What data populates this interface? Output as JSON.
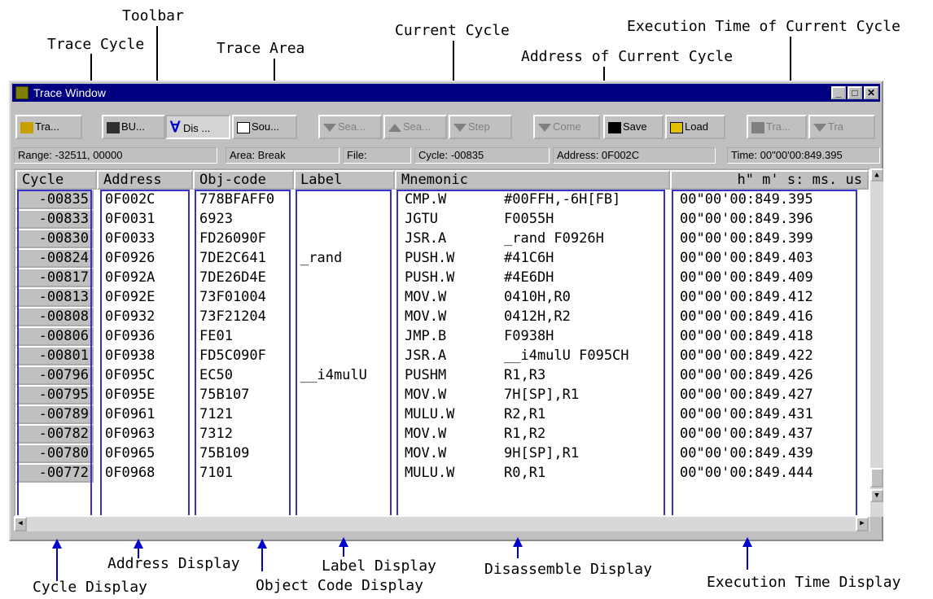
{
  "annotations": {
    "toolbar": "Toolbar",
    "trace_cycle": "Trace Cycle",
    "trace_area": "Trace Area",
    "current_cycle": "Current Cycle",
    "exec_time_current": "Execution Time of Current Cycle",
    "address_current": "Address of Current Cycle",
    "address_display": "Address Display",
    "cycle_display": "Cycle Display",
    "object_code_display": "Object Code Display",
    "label_display": "Label Display",
    "disassemble_display": "Disassemble Display",
    "execution_time_display": "Execution Time Display"
  },
  "window": {
    "title": "Trace Window",
    "min": "_",
    "max": "□",
    "close": "✕"
  },
  "toolbar": {
    "buttons": [
      {
        "label": "Tra...",
        "icon": "trace-icon"
      },
      {
        "label": "BU...",
        "icon": "bus-icon"
      },
      {
        "label": "Dis ...",
        "icon": "disassemble-icon",
        "prefix": "∀"
      },
      {
        "label": "Sou...",
        "icon": "source-icon"
      },
      {
        "label": "Sea...",
        "icon": "search-down-icon"
      },
      {
        "label": "Sea...",
        "icon": "search-up-icon"
      },
      {
        "label": "Step",
        "icon": "step-icon"
      },
      {
        "label": "Come",
        "icon": "come-icon"
      },
      {
        "label": "Save",
        "icon": "save-icon"
      },
      {
        "label": "Load",
        "icon": "load-icon"
      },
      {
        "label": "Tra...",
        "icon": "trace-stop-icon"
      },
      {
        "label": "Tra",
        "icon": "trace-next-icon"
      }
    ]
  },
  "status": {
    "range": "Range: -32511,  00000",
    "area": "Area: Break",
    "file": "File:",
    "cycle": "Cycle: -00835",
    "address": "Address: 0F002C",
    "time": "Time: 00\"00'00:849.395"
  },
  "columns": {
    "cycle": "Cycle",
    "address": "Address",
    "objcode": "Obj-code",
    "label": "Label",
    "mnemonic": "Mnemonic",
    "time": "h\"  m'  s: ms. us"
  },
  "rows": [
    {
      "cycle": "-00835",
      "address": "0F002C",
      "obj": "778BFAFF0",
      "label": "",
      "mn": "CMP.W",
      "op": "#00FFH,-6H[FB]",
      "time": "00\"00'00:849.395"
    },
    {
      "cycle": "-00833",
      "address": "0F0031",
      "obj": "6923",
      "label": "",
      "mn": "JGTU",
      "op": "F0055H",
      "time": "00\"00'00:849.396"
    },
    {
      "cycle": "-00830",
      "address": "0F0033",
      "obj": "FD26090F",
      "label": "",
      "mn": "JSR.A",
      "op": "_rand F0926H",
      "time": "00\"00'00:849.399"
    },
    {
      "cycle": "-00824",
      "address": "0F0926",
      "obj": "7DE2C641",
      "label": "_rand",
      "mn": "PUSH.W",
      "op": "#41C6H",
      "time": "00\"00'00:849.403"
    },
    {
      "cycle": "-00817",
      "address": "0F092A",
      "obj": "7DE26D4E",
      "label": "",
      "mn": "PUSH.W",
      "op": "#4E6DH",
      "time": "00\"00'00:849.409"
    },
    {
      "cycle": "-00813",
      "address": "0F092E",
      "obj": "73F01004",
      "label": "",
      "mn": "MOV.W",
      "op": "0410H,R0",
      "time": "00\"00'00:849.412"
    },
    {
      "cycle": "-00808",
      "address": "0F0932",
      "obj": "73F21204",
      "label": "",
      "mn": "MOV.W",
      "op": "0412H,R2",
      "time": "00\"00'00:849.416"
    },
    {
      "cycle": "-00806",
      "address": "0F0936",
      "obj": "FE01",
      "label": "",
      "mn": "JMP.B",
      "op": "F0938H",
      "time": "00\"00'00:849.418"
    },
    {
      "cycle": "-00801",
      "address": "0F0938",
      "obj": "FD5C090F",
      "label": "",
      "mn": "JSR.A",
      "op": "__i4mulU F095CH",
      "time": "00\"00'00:849.422"
    },
    {
      "cycle": "-00796",
      "address": "0F095C",
      "obj": "EC50",
      "label": "__i4mulU",
      "mn": "PUSHM",
      "op": "R1,R3",
      "time": "00\"00'00:849.426"
    },
    {
      "cycle": "-00795",
      "address": "0F095E",
      "obj": "75B107",
      "label": "",
      "mn": "MOV.W",
      "op": "7H[SP],R1",
      "time": "00\"00'00:849.427"
    },
    {
      "cycle": "-00789",
      "address": "0F0961",
      "obj": "7121",
      "label": "",
      "mn": "MULU.W",
      "op": "R2,R1",
      "time": "00\"00'00:849.431"
    },
    {
      "cycle": "-00782",
      "address": "0F0963",
      "obj": "7312",
      "label": "",
      "mn": "MOV.W",
      "op": "R1,R2",
      "time": "00\"00'00:849.437"
    },
    {
      "cycle": "-00780",
      "address": "0F0965",
      "obj": "75B109",
      "label": "",
      "mn": "MOV.W",
      "op": "9H[SP],R1",
      "time": "00\"00'00:849.439"
    },
    {
      "cycle": "-00772",
      "address": "0F0968",
      "obj": "7101",
      "label": "",
      "mn": "MULU.W",
      "op": "R0,R1",
      "time": "00\"00'00:849.444"
    }
  ]
}
